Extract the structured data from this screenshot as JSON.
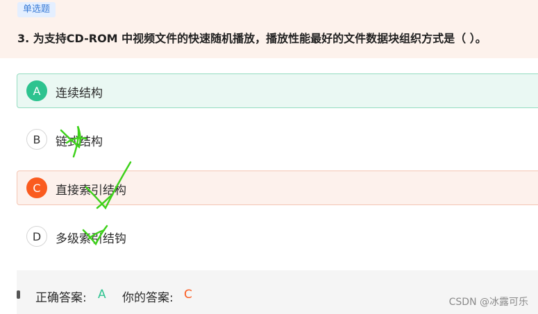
{
  "question": {
    "type_tag": "单选题",
    "text": "3. 为支持CD-ROM 中视频文件的快速随机播放，播放性能最好的文件数据块组织方式是（ ）。"
  },
  "options": [
    {
      "letter": "A",
      "text": "连续结构",
      "state": "correct"
    },
    {
      "letter": "B",
      "text": "链式结构",
      "state": "normal"
    },
    {
      "letter": "C",
      "text": "直接索引结构",
      "state": "wrong"
    },
    {
      "letter": "D",
      "text": "多级索引结钩",
      "state": "normal"
    }
  ],
  "answer": {
    "correct_label": "正确答案:",
    "correct_value": "A",
    "yours_label": "你的答案:",
    "yours_value": "C"
  },
  "watermark": "CSDN @冰露可乐",
  "colors": {
    "correct": "#2dc38f",
    "wrong": "#fa5b1f",
    "check_mark": "#3ed11a",
    "header_bg": "#fdf2ec"
  },
  "icons": [
    "handwritten-check-mark-icon"
  ]
}
